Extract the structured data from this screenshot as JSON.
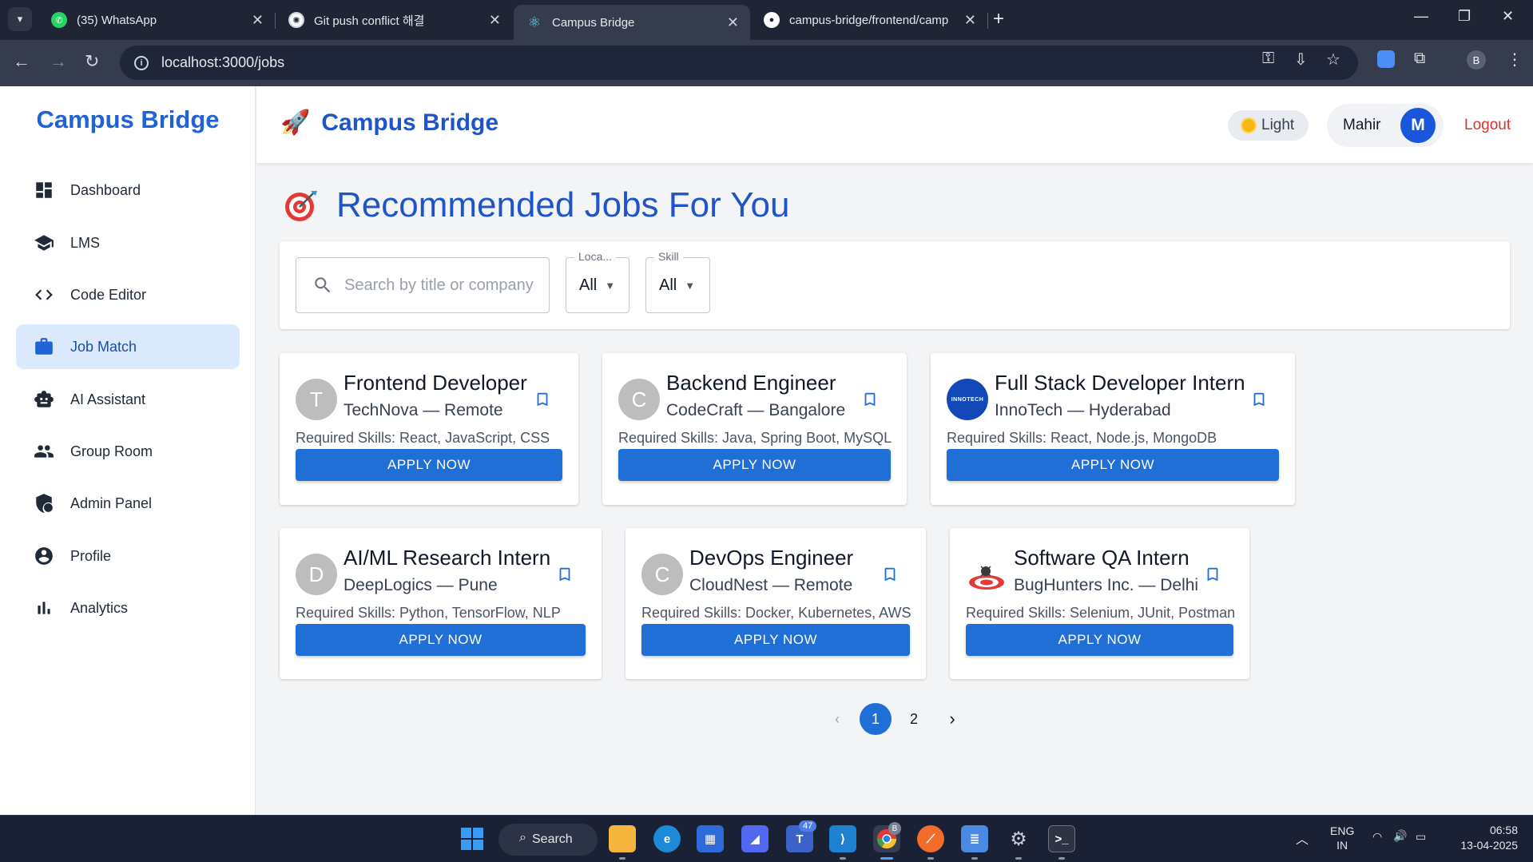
{
  "browser": {
    "tabs": [
      {
        "title": "(35) WhatsApp",
        "icon": "whatsapp-icon"
      },
      {
        "title": "Git push conflict 해결",
        "icon": "chatgpt-icon"
      },
      {
        "title": "Campus Bridge",
        "icon": "react-icon",
        "active": true
      },
      {
        "title": "campus-bridge/frontend/camp",
        "icon": "github-icon"
      }
    ],
    "url": "localhost:3000/jobs",
    "profile_initial": "B"
  },
  "sidebar": {
    "brand": "Campus Bridge",
    "items": [
      {
        "label": "Dashboard",
        "icon": "dashboard-icon"
      },
      {
        "label": "LMS",
        "icon": "school-icon"
      },
      {
        "label": "Code Editor",
        "icon": "code-icon"
      },
      {
        "label": "Job Match",
        "icon": "briefcase-icon",
        "active": true
      },
      {
        "label": "AI Assistant",
        "icon": "robot-icon"
      },
      {
        "label": "Group Room",
        "icon": "group-icon"
      },
      {
        "label": "Admin Panel",
        "icon": "admin-shield-icon"
      },
      {
        "label": "Profile",
        "icon": "profile-icon"
      },
      {
        "label": "Analytics",
        "icon": "analytics-icon"
      }
    ]
  },
  "header": {
    "brand": "Campus Bridge",
    "theme_label": "Light",
    "user_name": "Mahir",
    "user_initial": "M",
    "logout_label": "Logout"
  },
  "main": {
    "title": "Recommended Jobs For You",
    "search_placeholder": "Search by title or company",
    "location_filter": {
      "label": "Loca...",
      "value": "All"
    },
    "skill_filter": {
      "label": "Skill",
      "value": "All"
    },
    "apply_label": "APPLY NOW",
    "jobs": [
      {
        "title": "Frontend Developer",
        "company_location": "TechNova — Remote",
        "skills": "Required Skills: React, JavaScript, CSS",
        "logo_letter": "T"
      },
      {
        "title": "Backend Engineer",
        "company_location": "CodeCraft — Bangalore",
        "skills": "Required Skills: Java, Spring Boot, MySQL",
        "logo_letter": "C"
      },
      {
        "title": "Full Stack Developer Intern",
        "company_location": "InnoTech — Hyderabad",
        "skills": "Required Skills: React, Node.js, MongoDB",
        "logo_text": "INNOTECH"
      },
      {
        "title": "AI/ML Research Intern",
        "company_location": "DeepLogics — Pune",
        "skills": "Required Skills: Python, TensorFlow, NLP",
        "logo_letter": "D"
      },
      {
        "title": "DevOps Engineer",
        "company_location": "CloudNest — Remote",
        "skills": "Required Skills: Docker, Kubernetes, AWS",
        "logo_letter": "C"
      },
      {
        "title": "Software QA Intern",
        "company_location": "BugHunters Inc. — Delhi",
        "skills": "Required Skills: Selenium, JUnit, Postman",
        "logo_icon": "bug-target-icon"
      }
    ],
    "pagination": {
      "pages": [
        "1",
        "2"
      ],
      "current": "1"
    }
  },
  "taskbar": {
    "search_label": "Search",
    "teams_badge": "47",
    "chrome_badge": "B",
    "lang": "ENG",
    "region": "IN",
    "time": "06:58",
    "date": "13-04-2025"
  },
  "colors": {
    "brand": "#1f55c9",
    "primary": "#1f6fd6",
    "logout": "#d6342c",
    "active_nav_bg": "#dbe9fc"
  }
}
